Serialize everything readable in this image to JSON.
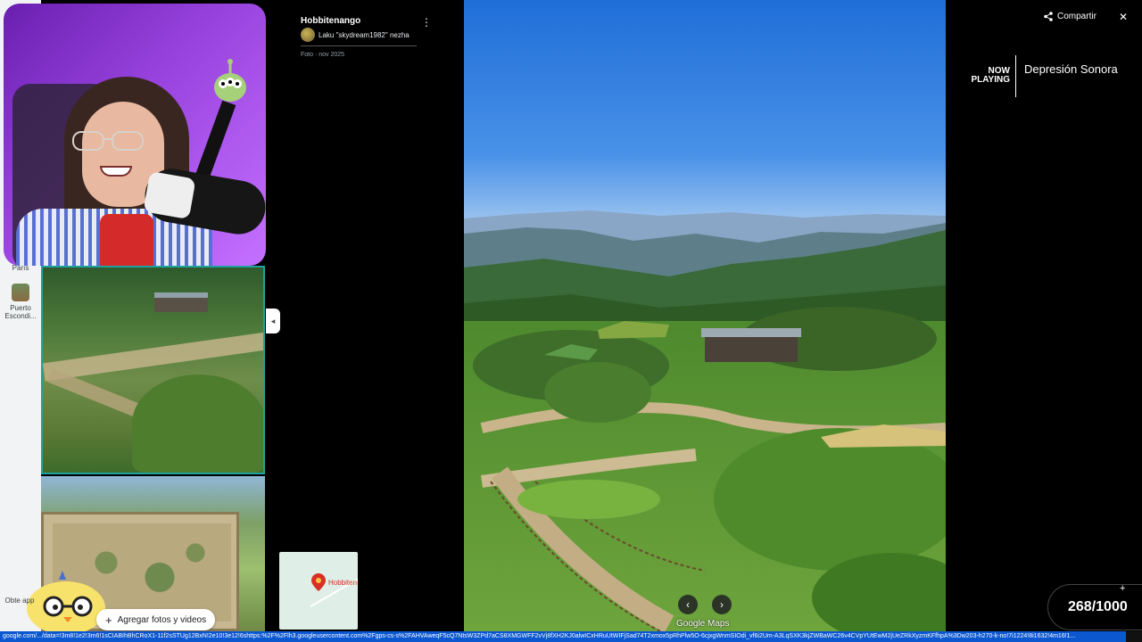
{
  "left_sidebar": {
    "items": [
      {
        "label": "París"
      },
      {
        "label": "Puerto Escondi..."
      }
    ],
    "obt_label": "Obte app"
  },
  "photo_panel": {
    "place_title": "Hobbitenango",
    "author": "Laku \"skydream1982\" nezha",
    "date": "Foto · nov 2025",
    "add_photos_label": "Agregar fotos y videos",
    "minimap_label": "Hobbiten"
  },
  "viewer": {
    "share_label": "Compartir",
    "brand_label": "Google Maps"
  },
  "stream_overlay": {
    "now_playing": "NOW PLAYING",
    "song": "Depresión Sonora",
    "counter": "268/1000"
  },
  "status_bar": {
    "url": "google.com/.../data=!3m8!1e2!3m6!1sCIABIhBhCRoX1-11f2sSTUg12BxN!2e10!3e12!6shttps:%2F%2Flh3.googleusercontent.com%2Fgps-cs-s%2FAHVAweqF5cQ7NtsW3ZPd7aCS8XMGWFF2vVj8fXH2KJ0alwICxHRuUtWIFjSad74T2xmox5pRhPlw5O-6cjxgWnmSIOdi_vf6i2Um-A3LqSXK3kjZWBaWC26v4CVpYUtEwM2jUeZRkXyzmKFfhpA%3Dw203-h270-k-no!7i1224!8i1632!4m16!1..."
  },
  "colors": {
    "accent_teal": "#1fa1a1",
    "status_blue": "#0b57d0",
    "pin_red": "#d93025"
  }
}
